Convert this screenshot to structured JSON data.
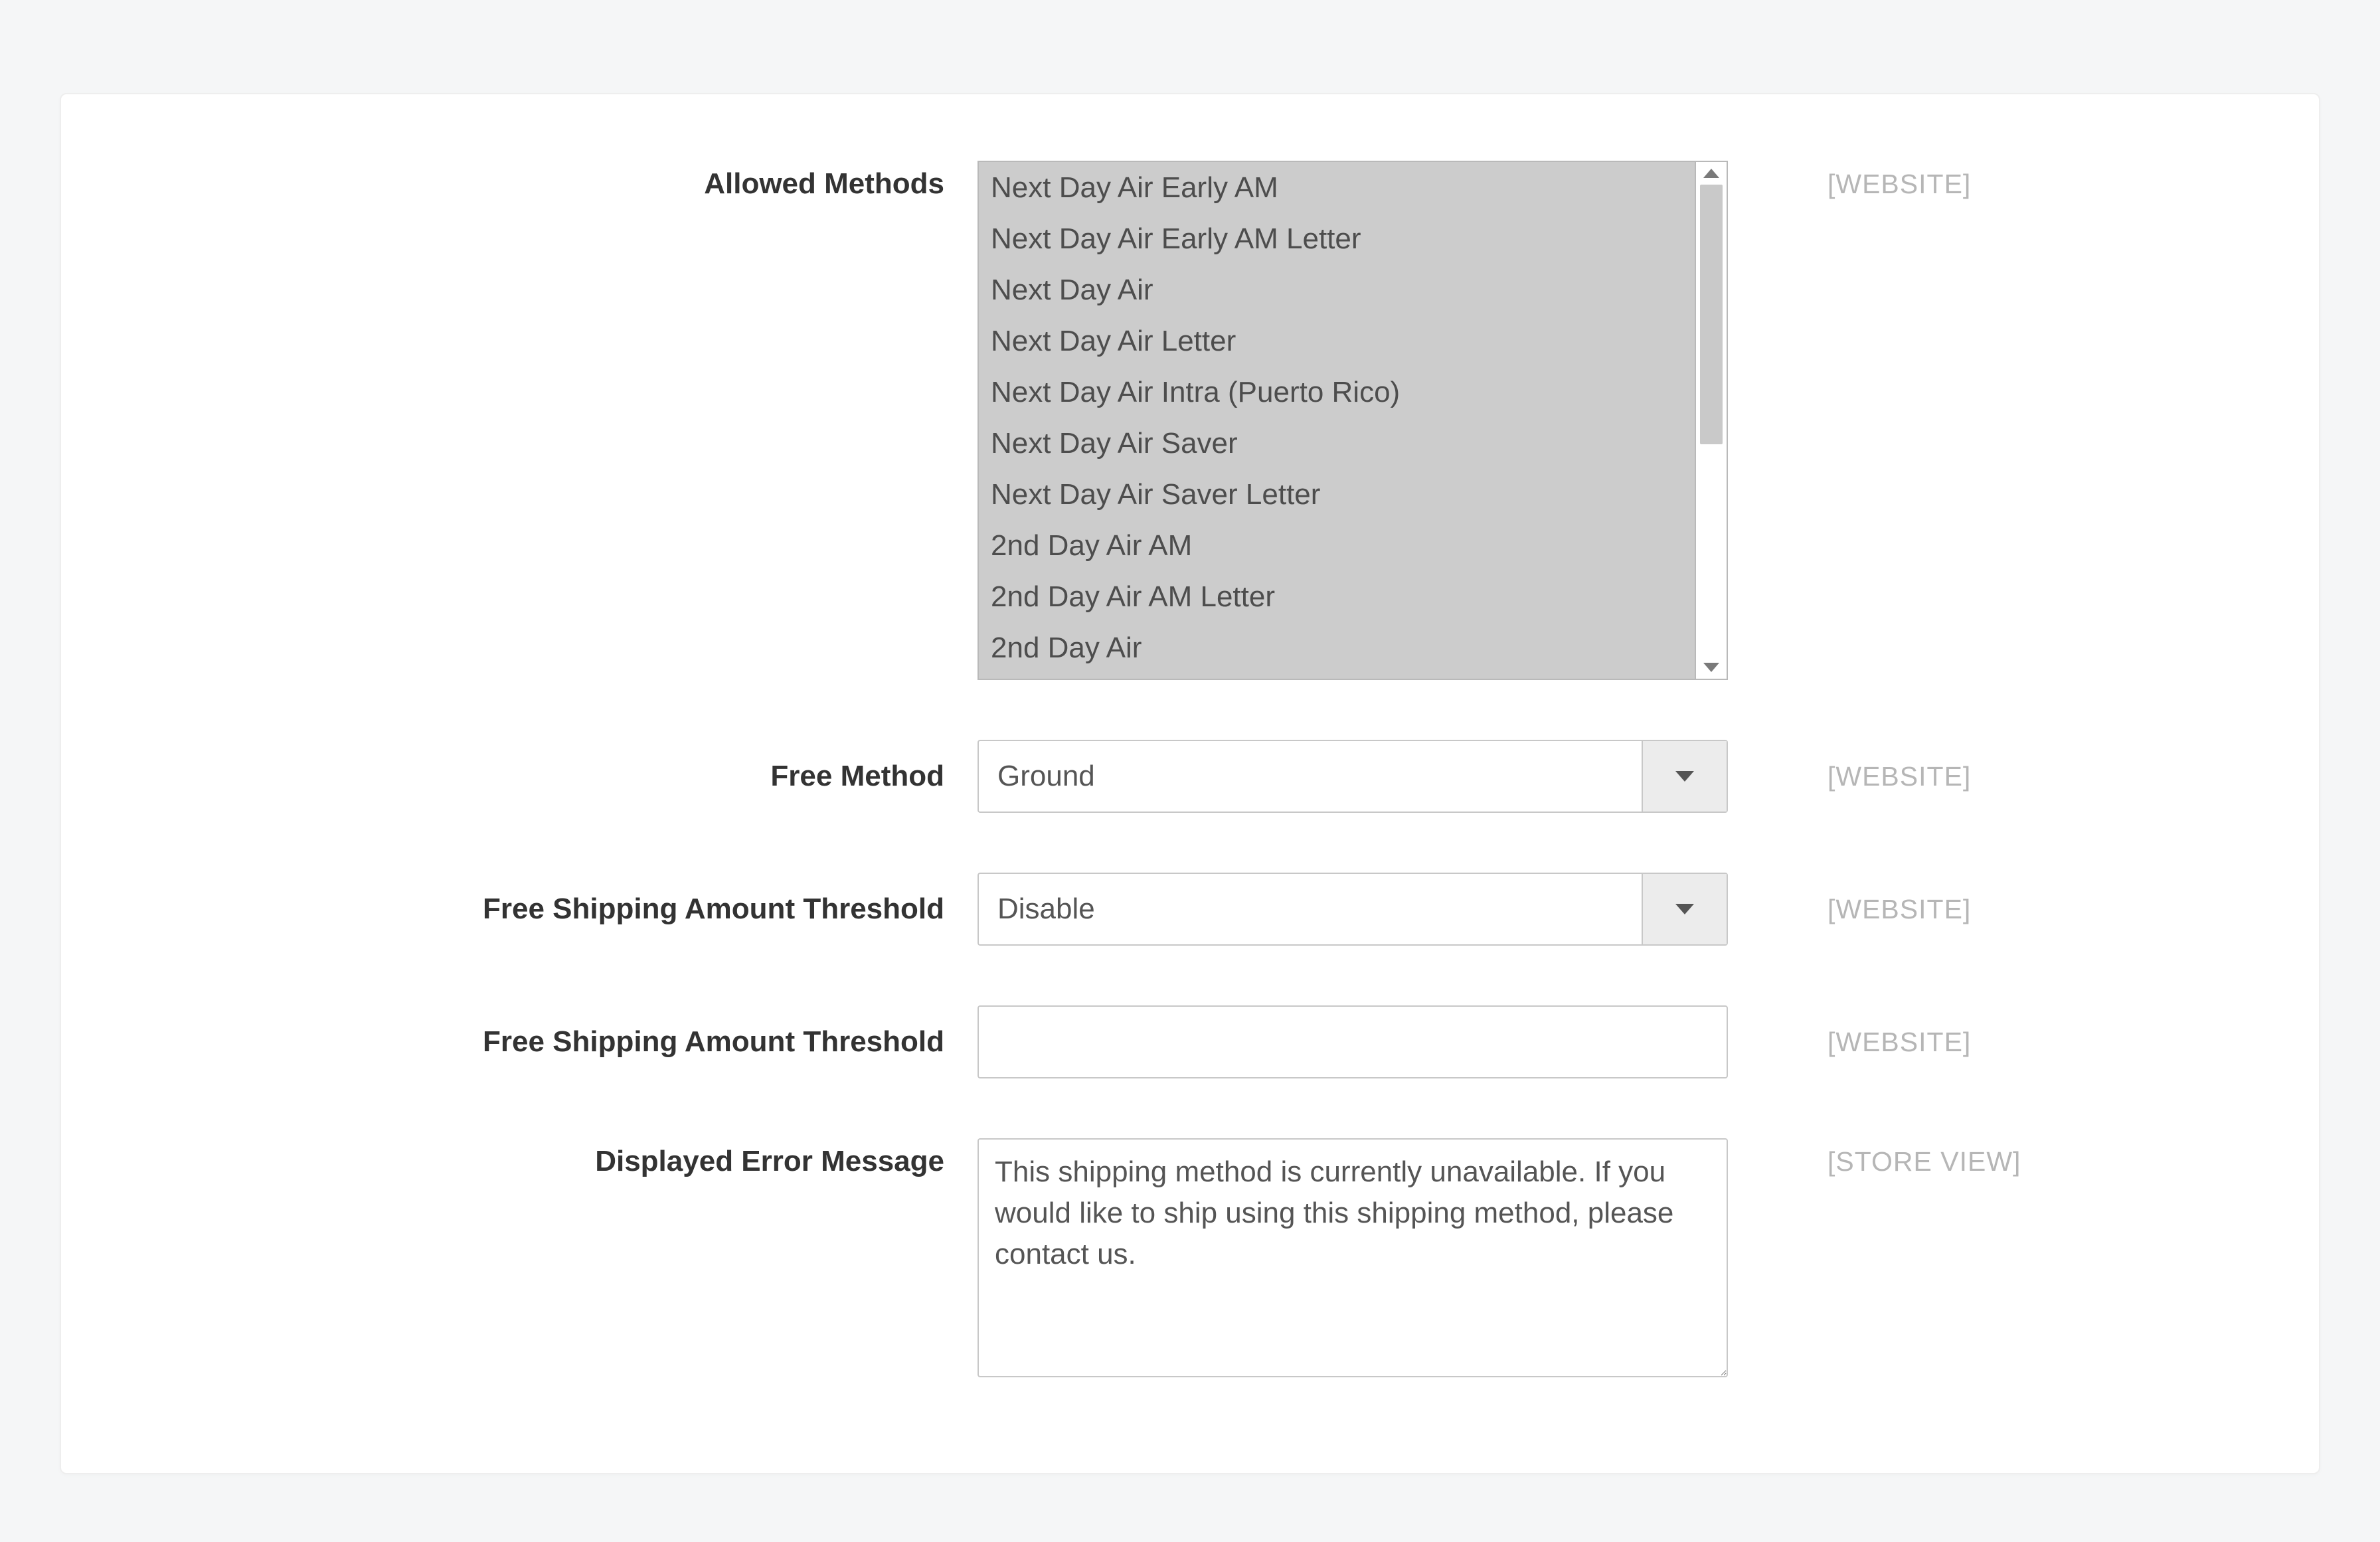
{
  "scopes": {
    "website": "[WEBSITE]",
    "store_view": "[STORE VIEW]"
  },
  "allowed_methods": {
    "label": "Allowed Methods",
    "scope": "[WEBSITE]",
    "options": [
      "Next Day Air Early AM",
      "Next Day Air Early AM Letter",
      "Next Day Air",
      "Next Day Air Letter",
      "Next Day Air Intra (Puerto Rico)",
      "Next Day Air Saver",
      "Next Day Air Saver Letter",
      "2nd Day Air AM",
      "2nd Day Air AM Letter",
      "2nd Day Air"
    ]
  },
  "free_method": {
    "label": "Free Method",
    "scope": "[WEBSITE]",
    "value": "Ground"
  },
  "free_shipping_threshold_select": {
    "label": "Free Shipping Amount Threshold",
    "scope": "[WEBSITE]",
    "value": "Disable"
  },
  "free_shipping_threshold_input": {
    "label": "Free Shipping Amount Threshold",
    "scope": "[WEBSITE]",
    "value": ""
  },
  "error_message": {
    "label": "Displayed Error Message",
    "scope": "[STORE VIEW]",
    "value": "This shipping method is currently unavailable. If you would like to ship using this shipping method, please contact us."
  }
}
